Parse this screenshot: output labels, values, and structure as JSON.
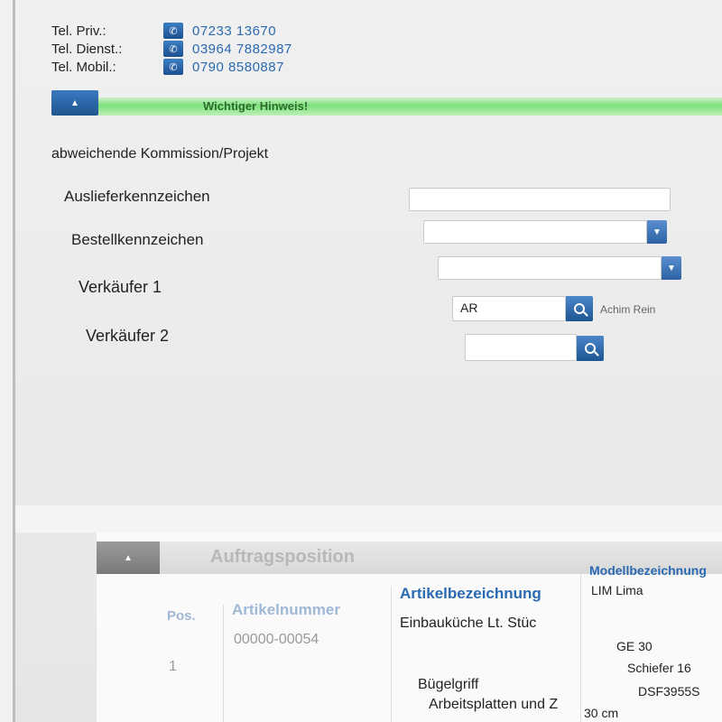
{
  "contact": {
    "rows": [
      {
        "label": "Tel. Priv.:",
        "value": "07233 13670"
      },
      {
        "label": "Tel. Dienst.:",
        "value": "03964 7882987"
      },
      {
        "label": "Tel. Mobil.:",
        "value": "0790 8580887"
      }
    ]
  },
  "notice": {
    "text": "Wichtiger Hinweis!"
  },
  "form": {
    "commission_label": "abweichende Kommission/Projekt",
    "delivery_label": "Auslieferkennzeichen",
    "order_label": "Bestellkennzeichen",
    "seller1_label": "Verkäufer 1",
    "seller1_value": "AR",
    "seller1_name": "Achim Rein",
    "seller2_label": "Verkäufer 2",
    "seller2_value": ""
  },
  "positions": {
    "title": "Auftragsposition",
    "columns": [
      "Pos.",
      "Artikelnummer",
      "Artikelbezeichnung",
      "Modellbezeichnung"
    ],
    "rows": [
      {
        "pos": "1",
        "artikelnummer": "00000-00054",
        "artikelbezeichnung": "Einbauküche Lt. Stüc",
        "modell": "LIM Lima"
      },
      {
        "pos": "",
        "artikelnummer": "",
        "artikelbezeichnung": "",
        "modell": "GE 30"
      },
      {
        "pos": "",
        "artikelnummer": "",
        "artikelbezeichnung": "Bügelgriff",
        "modell": "Schiefer 16"
      },
      {
        "pos": "",
        "artikelnummer": "",
        "artikelbezeichnung": "Arbeitsplatten und Z",
        "modell": "DSF3955S"
      },
      {
        "pos": "",
        "artikelnummer": "",
        "artikelbezeichnung": "",
        "modell": "30 cm"
      }
    ]
  },
  "colors": {
    "accent": "#2a6ab3",
    "notice_green": "#7be27a"
  }
}
